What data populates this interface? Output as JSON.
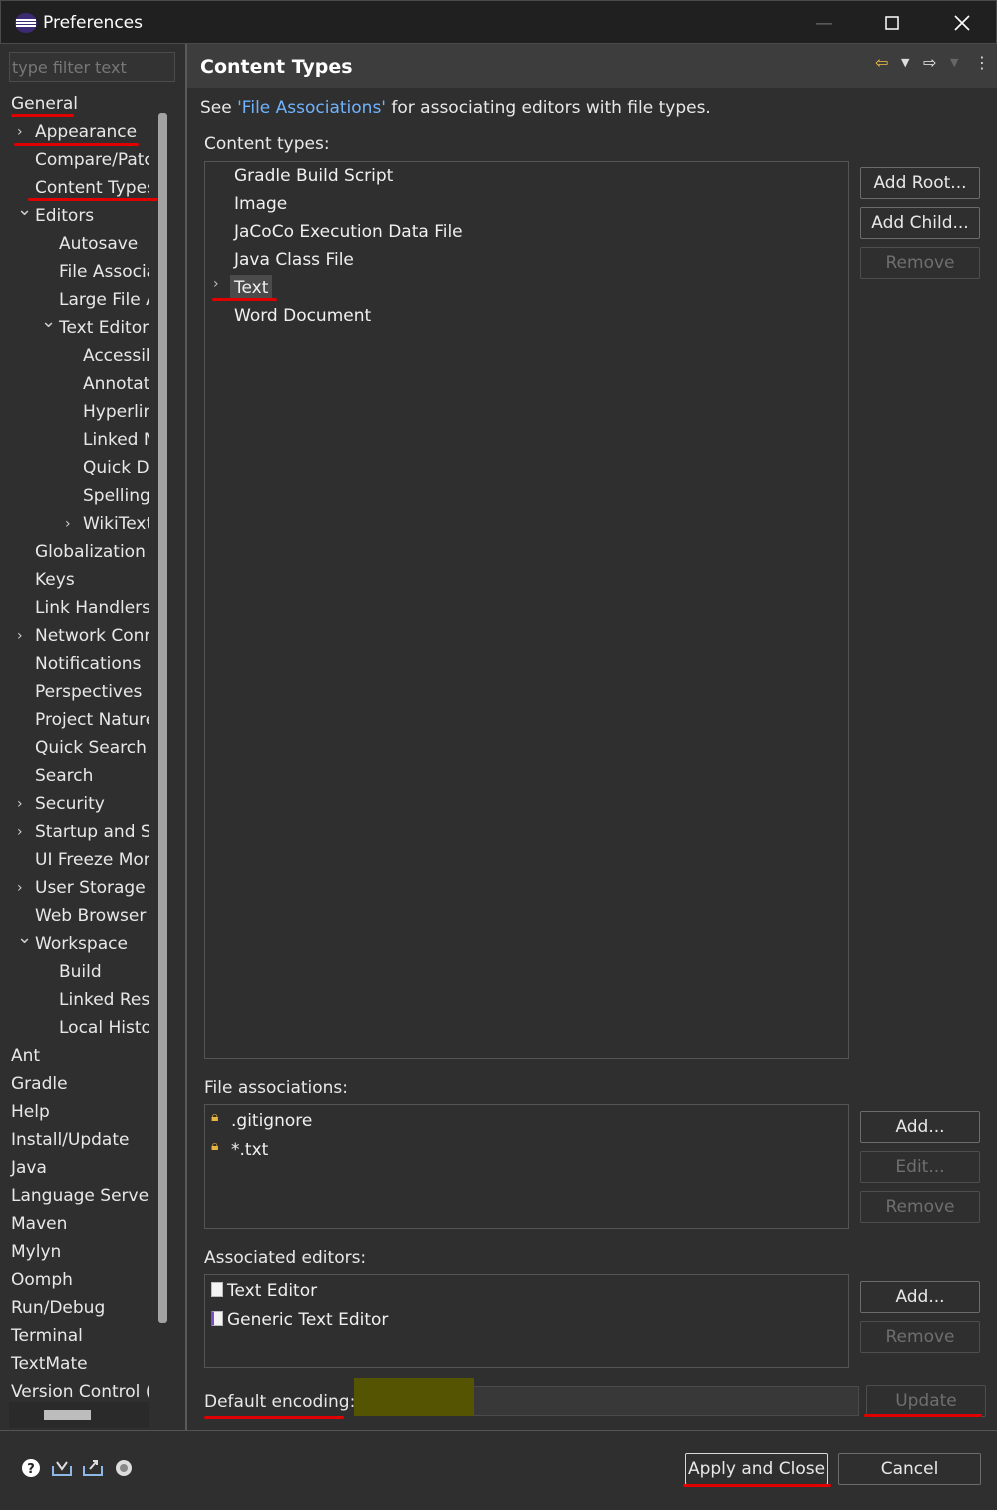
{
  "window": {
    "title": "Preferences"
  },
  "filter": {
    "placeholder": "type filter text"
  },
  "tree": [
    {
      "label": "General",
      "indent": 0,
      "arrow": ""
    },
    {
      "label": "Appearance",
      "indent": 1,
      "arrow": "collapsed"
    },
    {
      "label": "Compare/Patc",
      "indent": 1,
      "arrow": ""
    },
    {
      "label": "Content Types",
      "indent": 1,
      "arrow": ""
    },
    {
      "label": "Editors",
      "indent": 1,
      "arrow": "expanded"
    },
    {
      "label": "Autosave",
      "indent": 2,
      "arrow": ""
    },
    {
      "label": "File Associa",
      "indent": 2,
      "arrow": ""
    },
    {
      "label": "Large File A",
      "indent": 2,
      "arrow": ""
    },
    {
      "label": "Text Editors",
      "indent": 2,
      "arrow": "expanded"
    },
    {
      "label": "Accessib",
      "indent": 3,
      "arrow": ""
    },
    {
      "label": "Annotati",
      "indent": 3,
      "arrow": ""
    },
    {
      "label": "Hyperlin",
      "indent": 3,
      "arrow": ""
    },
    {
      "label": "Linked M",
      "indent": 3,
      "arrow": ""
    },
    {
      "label": "Quick D",
      "indent": 3,
      "arrow": ""
    },
    {
      "label": "Spelling",
      "indent": 3,
      "arrow": ""
    },
    {
      "label": "WikiText",
      "indent": 3,
      "arrow": "collapsed"
    },
    {
      "label": "Globalization",
      "indent": 1,
      "arrow": ""
    },
    {
      "label": "Keys",
      "indent": 1,
      "arrow": ""
    },
    {
      "label": "Link Handlers",
      "indent": 1,
      "arrow": ""
    },
    {
      "label": "Network Conn",
      "indent": 1,
      "arrow": "collapsed"
    },
    {
      "label": "Notifications",
      "indent": 1,
      "arrow": ""
    },
    {
      "label": "Perspectives",
      "indent": 1,
      "arrow": ""
    },
    {
      "label": "Project Nature",
      "indent": 1,
      "arrow": ""
    },
    {
      "label": "Quick Search",
      "indent": 1,
      "arrow": ""
    },
    {
      "label": "Search",
      "indent": 1,
      "arrow": ""
    },
    {
      "label": "Security",
      "indent": 1,
      "arrow": "collapsed"
    },
    {
      "label": "Startup and Sh",
      "indent": 1,
      "arrow": "collapsed"
    },
    {
      "label": "UI Freeze Mon",
      "indent": 1,
      "arrow": ""
    },
    {
      "label": "User Storage S",
      "indent": 1,
      "arrow": "collapsed"
    },
    {
      "label": "Web Browser",
      "indent": 1,
      "arrow": ""
    },
    {
      "label": "Workspace",
      "indent": 1,
      "arrow": "expanded"
    },
    {
      "label": "Build",
      "indent": 2,
      "arrow": ""
    },
    {
      "label": "Linked Reso",
      "indent": 2,
      "arrow": ""
    },
    {
      "label": "Local Histo",
      "indent": 2,
      "arrow": ""
    },
    {
      "label": "Ant",
      "indent": 0,
      "arrow": ""
    },
    {
      "label": "Gradle",
      "indent": 0,
      "arrow": ""
    },
    {
      "label": "Help",
      "indent": 0,
      "arrow": ""
    },
    {
      "label": "Install/Update",
      "indent": 0,
      "arrow": ""
    },
    {
      "label": "Java",
      "indent": 0,
      "arrow": ""
    },
    {
      "label": "Language Servers",
      "indent": 0,
      "arrow": ""
    },
    {
      "label": "Maven",
      "indent": 0,
      "arrow": ""
    },
    {
      "label": "Mylyn",
      "indent": 0,
      "arrow": ""
    },
    {
      "label": "Oomph",
      "indent": 0,
      "arrow": ""
    },
    {
      "label": "Run/Debug",
      "indent": 0,
      "arrow": ""
    },
    {
      "label": "Terminal",
      "indent": 0,
      "arrow": ""
    },
    {
      "label": "TextMate",
      "indent": 0,
      "arrow": ""
    },
    {
      "label": "Version Control (",
      "indent": 0,
      "arrow": ""
    }
  ],
  "page": {
    "title": "Content Types",
    "see_prefix": "See ",
    "see_link": "'File Associations'",
    "see_suffix": " for associating editors with file types.",
    "content_types_label": "Content types:",
    "content_types": [
      "Gradle Build Script",
      "Image",
      "JaCoCo Execution Data File",
      "Java Class File",
      "Text",
      "Word Document"
    ],
    "selected_content_type": "Text",
    "add_root": "Add Root...",
    "add_child": "Add Child...",
    "remove": "Remove",
    "file_assoc_label": "File associations:",
    "file_associations": [
      ".gitignore",
      "*.txt"
    ],
    "add": "Add...",
    "edit": "Edit...",
    "assoc_editors_label": "Associated editors:",
    "associated_editors": [
      "Text Editor",
      "Generic Text Editor"
    ],
    "default_encoding_label": "Default encoding:",
    "default_encoding_value": "",
    "update": "Update"
  },
  "footer": {
    "apply_close": "Apply and Close",
    "cancel": "Cancel"
  },
  "colors": {
    "accent_red": "#e00000",
    "link": "#6fb3ff",
    "encoding_highlight": "#545403"
  }
}
